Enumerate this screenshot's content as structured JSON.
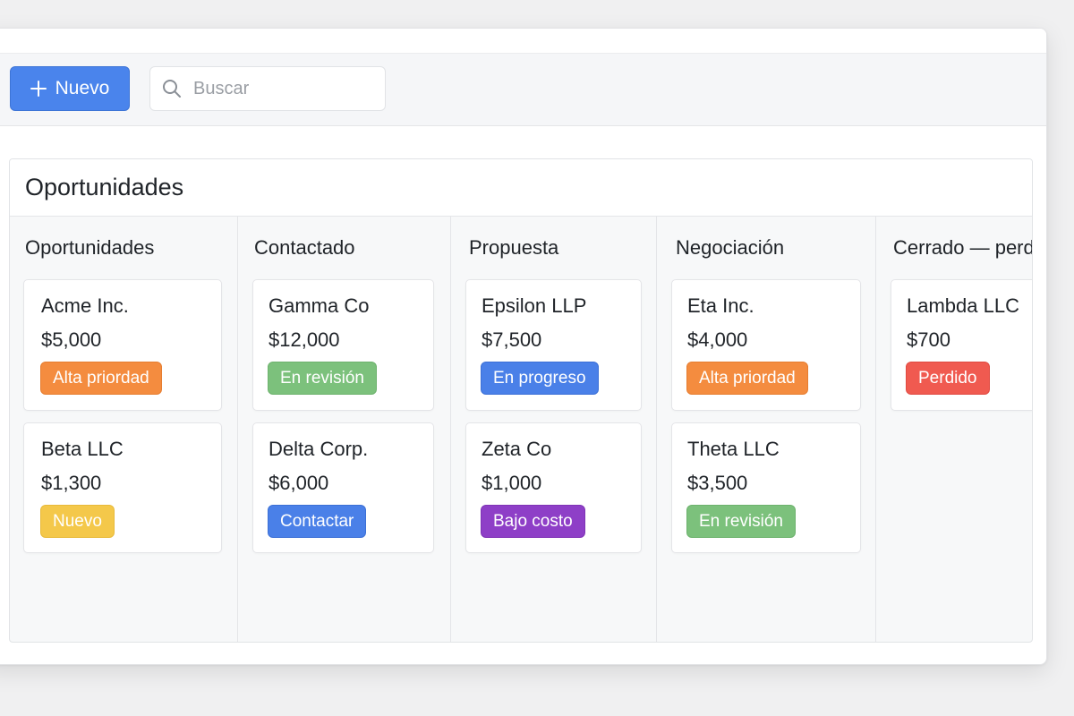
{
  "toolbar": {
    "new_label": "Nuevo",
    "search_placeholder": "Buscar"
  },
  "board": {
    "title": "Oportunidades",
    "columns": [
      {
        "title": "Oportunidades",
        "cards": [
          {
            "name": "Acme Inc.",
            "amount": "$5,000",
            "badge": "Alta priordad",
            "badge_color": "#f48c3f"
          },
          {
            "name": "Beta LLC",
            "amount": "$1,300",
            "badge": "Nuevo",
            "badge_color": "#f4c84a"
          }
        ]
      },
      {
        "title": "Contactado",
        "cards": [
          {
            "name": "Gamma Co",
            "amount": "$12,000",
            "badge": "En revisión",
            "badge_color": "#7cc17c"
          },
          {
            "name": "Delta Corp.",
            "amount": "$6,000",
            "badge": "Contactar",
            "badge_color": "#4a80e8"
          }
        ]
      },
      {
        "title": "Propuesta",
        "cards": [
          {
            "name": "Epsilon LLP",
            "amount": "$7,500",
            "badge": "En progreso",
            "badge_color": "#4a80e8"
          },
          {
            "name": "Zeta Co",
            "amount": "$1,000",
            "badge": "Bajo costo",
            "badge_color": "#8e3fc7"
          }
        ]
      },
      {
        "title": "Negociación",
        "cards": [
          {
            "name": "Eta Inc.",
            "amount": "$4,000",
            "badge": "Alta priordad",
            "badge_color": "#f48c3f"
          },
          {
            "name": "Theta LLC",
            "amount": "$3,500",
            "badge": "En revisión",
            "badge_color": "#7cc17c"
          }
        ]
      },
      {
        "title": "Cerrado — perd",
        "cards": [
          {
            "name": "Lambda LLC",
            "amount": "$700",
            "badge": "Perdido",
            "badge_color": "#f05a50"
          }
        ]
      }
    ]
  },
  "colors": {
    "accent": "#4a84ec"
  },
  "icons": {
    "new": "plus-icon",
    "search": "search-icon"
  }
}
